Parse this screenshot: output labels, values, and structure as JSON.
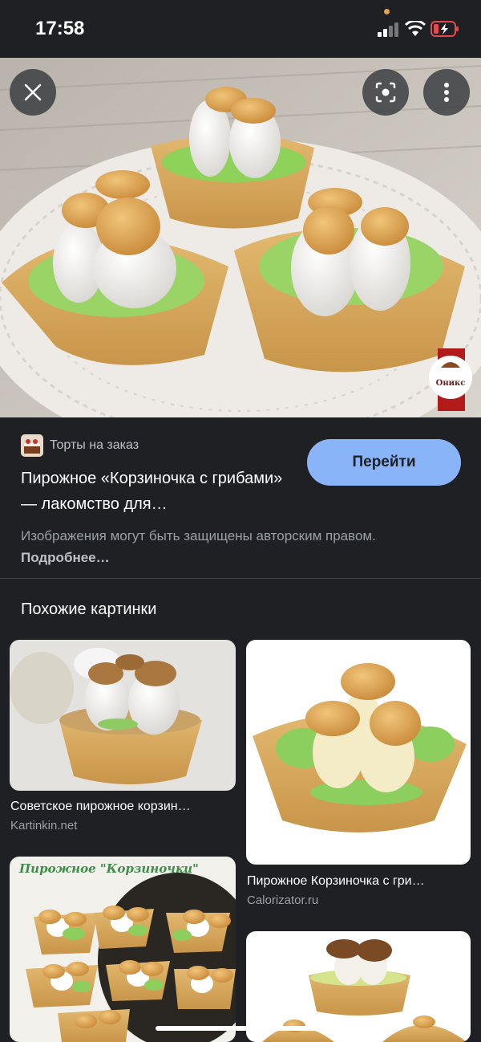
{
  "status_bar": {
    "time": "17:58"
  },
  "hero": {
    "watermark_text": "Оникс"
  },
  "source": {
    "name": "Торты на заказ"
  },
  "visit_button": "Перейти",
  "title": "Пирожное «Корзиночка с грибами» — лакомство для…",
  "copyright": {
    "text": "Изображения могут быть защищены авторским правом.",
    "more_link": "Подробнее…"
  },
  "section_title": "Похожие картинки",
  "tiles": [
    {
      "caption": "Советское пирожное корзин…",
      "source": "Kartinkin.net"
    },
    {
      "caption": "Пирожное Корзиночка с гри…",
      "source": "Calorizator.ru"
    },
    {
      "banner_text": "Пирожное \"Корзиночки\""
    },
    {}
  ]
}
